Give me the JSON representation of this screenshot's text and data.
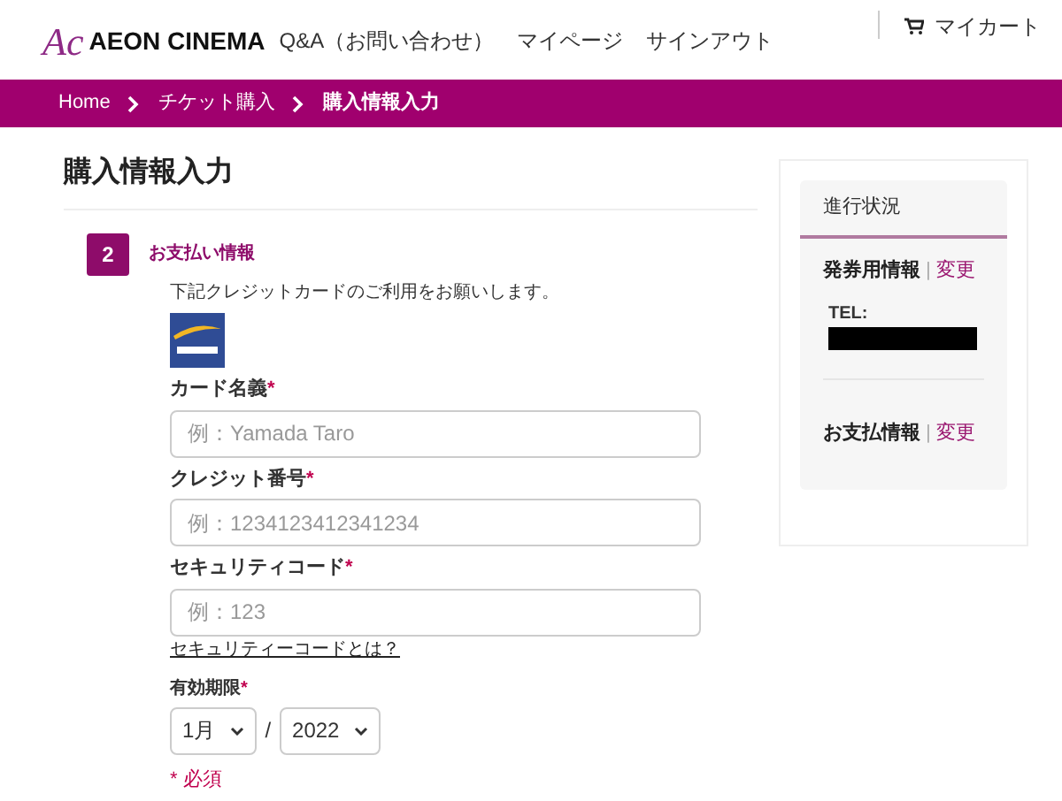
{
  "header": {
    "logo_mark": "Ac",
    "logo_text": "AEON CINEMA",
    "nav": [
      "Q&A（お問い合わせ）",
      "マイページ",
      "サインアウト"
    ],
    "cart": "マイカート"
  },
  "breadcrumb": [
    {
      "label": "Home",
      "current": false
    },
    {
      "label": "チケット購入",
      "current": false
    },
    {
      "label": "購入情報入力",
      "current": true
    }
  ],
  "page_title": "購入情報入力",
  "step": {
    "number": "2",
    "title": "お支払い情報"
  },
  "intro": "下記クレジットカードのご利用をお願いします。",
  "fields": [
    {
      "label": "カード名義",
      "required_mark": "*",
      "placeholder": "例：Yamada Taro"
    },
    {
      "label": "クレジット番号",
      "required_mark": "*",
      "placeholder": "例：1234123412341234"
    },
    {
      "label": "セキュリティコード",
      "required_mark": "*",
      "placeholder": "例：123"
    }
  ],
  "security_link": "セキュリティーコードとは？",
  "expiry": {
    "label": "有効期限",
    "required_mark": "*",
    "month": "1月",
    "separator": "/",
    "year": "2022"
  },
  "required_note": "* 必須",
  "progress": {
    "title": "進行状況",
    "sections": [
      {
        "label": "発券用情報",
        "divider": "|",
        "link": "変更",
        "detail": "TEL:"
      },
      {
        "label": "お支払情報",
        "divider": "|",
        "link": "変更"
      }
    ]
  }
}
